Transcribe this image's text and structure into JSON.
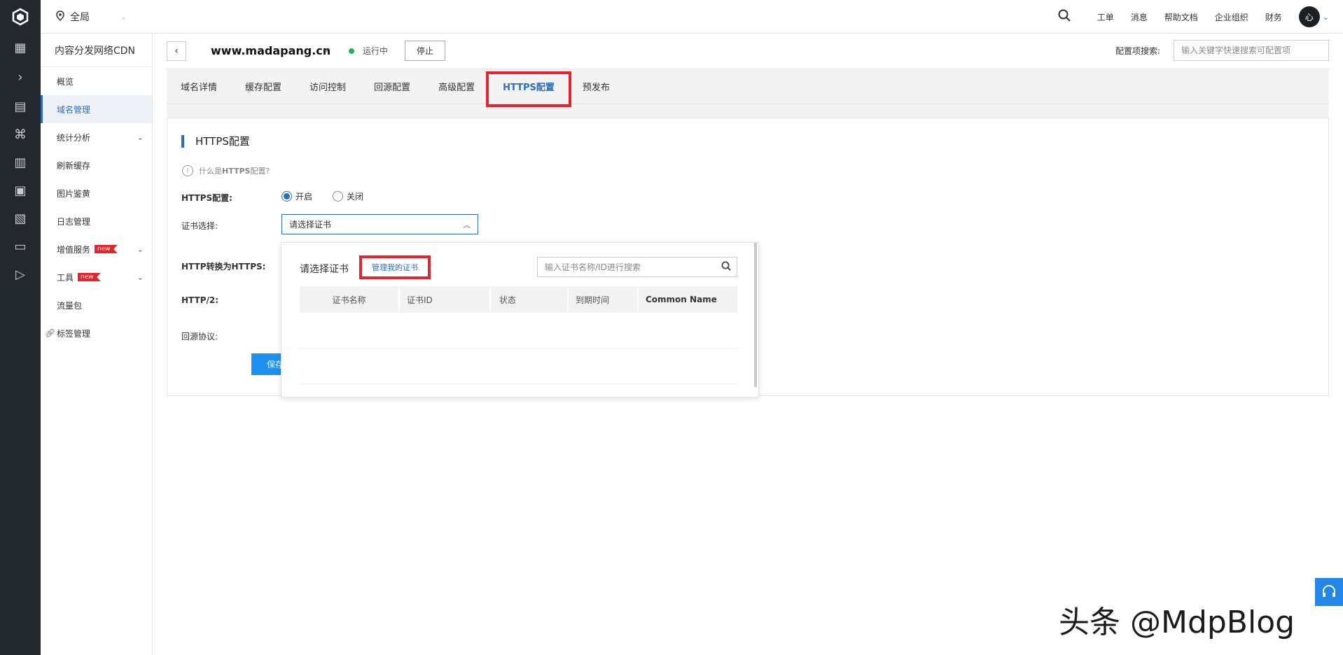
{
  "topbar": {
    "region": "全局",
    "nav": [
      "工单",
      "消息",
      "帮助文档",
      "企业组织",
      "财务"
    ],
    "avatar_text": "心"
  },
  "rail": {
    "icons": [
      "grid-icon",
      "chevron-right-icon",
      "dashboard-icon",
      "command-icon",
      "building-icon",
      "document-icon",
      "book-icon",
      "video-icon",
      "play-icon"
    ]
  },
  "sidebar": {
    "title": "内容分发网络CDN",
    "items": [
      {
        "label": "概览"
      },
      {
        "label": "域名管理"
      },
      {
        "label": "统计分析"
      },
      {
        "label": "刷新缓存"
      },
      {
        "label": "图片鉴黄"
      },
      {
        "label": "日志管理"
      },
      {
        "label": "增值服务",
        "badge": "new"
      },
      {
        "label": "工具",
        "badge": "new"
      },
      {
        "label": "流量包"
      },
      {
        "label": "标签管理"
      }
    ]
  },
  "domain": {
    "name": "www.madapang.cn",
    "status": "运行中",
    "stop_label": "停止",
    "config_search_label": "配置项搜索:",
    "config_search_placeholder": "输入关键字快速搜索可配置项"
  },
  "tabs": [
    "域名详情",
    "缓存配置",
    "访问控制",
    "回源配置",
    "高级配置",
    "HTTPS配置",
    "预发布"
  ],
  "https_panel": {
    "title": "HTTPS配置",
    "help_prefix": "什么是",
    "help_bold": "HTTPS",
    "help_suffix": "配置?",
    "label_https": "HTTPS配置:",
    "radio_on": "开启",
    "radio_off": "关闭",
    "label_cert": "证书选择:",
    "cert_placeholder": "请选择证书",
    "label_redirect_a": "HTTP转换为",
    "label_redirect_b": "HTTPS:",
    "label_http2": "HTTP/2:",
    "label_origin": "回源协议:",
    "save_label": "保存"
  },
  "cert_popup": {
    "title": "请选择证书",
    "manage_link": "管理我的证书",
    "search_placeholder": "输入证书名称/ID进行搜索",
    "columns": [
      "证书名称",
      "证书ID",
      "状态",
      "到期时间",
      "Common Name"
    ]
  },
  "watermark": "头条 @MdpBlog",
  "colors": {
    "accent": "#2a6ebd",
    "highlight": "#e0262e",
    "primary_button": "#1f8ff0",
    "rail_bg": "#23272e",
    "status_running": "#27ae60"
  }
}
